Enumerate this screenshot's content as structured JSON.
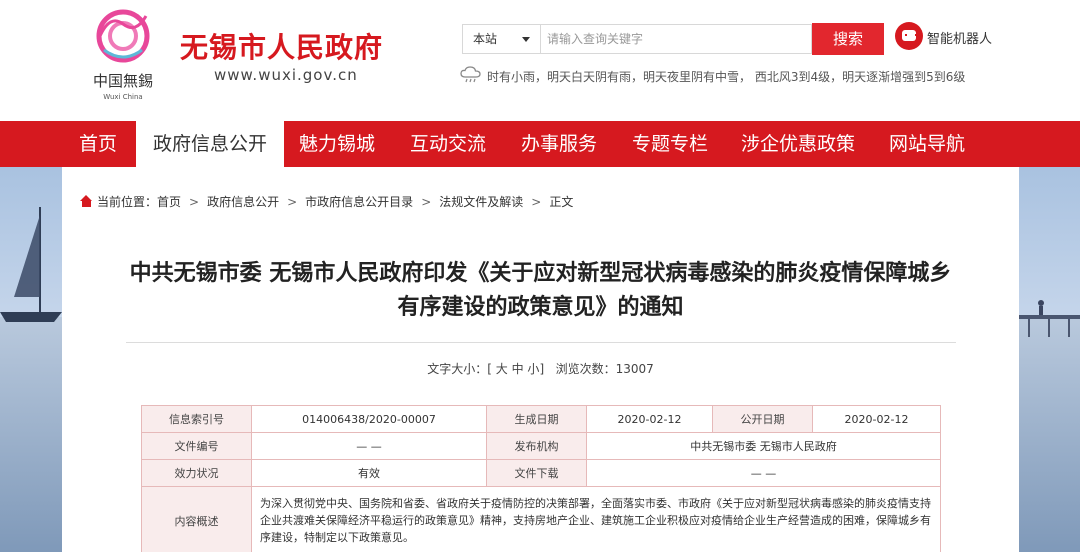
{
  "header": {
    "logo_text": "中国無錫",
    "logo_subtext": "Wuxi China",
    "site_title": "无锡市人民政府",
    "site_domain": "www.wuxi.gov.cn",
    "search": {
      "scope_value": "本站",
      "placeholder": "请输入查询关键字",
      "button_label": "搜索"
    },
    "robot_label": "智能机器人",
    "weather_icon": "cloud-rain-icon",
    "weather_text": "时有小雨，明天白天阴有雨，明天夜里阴有中雪， 西北风3到4级，明天逐渐增强到5到6级"
  },
  "nav": {
    "items": [
      {
        "label": "首页"
      },
      {
        "label": "政府信息公开",
        "active": true
      },
      {
        "label": "魅力锡城"
      },
      {
        "label": "互动交流"
      },
      {
        "label": "办事服务"
      },
      {
        "label": "专题专栏"
      },
      {
        "label": "涉企优惠政策"
      },
      {
        "label": "网站导航"
      }
    ]
  },
  "breadcrumb": {
    "prefix": "当前位置：",
    "items": [
      "首页",
      "政府信息公开",
      "市政府信息公开目录",
      "法规文件及解读",
      "正文"
    ],
    "separator": ">"
  },
  "article": {
    "title_line1": "中共无锡市委 无锡市人民政府印发《关于应对新型冠状病毒感染的肺炎疫情保障城乡",
    "title_line2": "有序建设的政策意见》的通知",
    "font_size_label": "文字大小：[",
    "font_large": "大",
    "font_medium": "中",
    "font_small": "小",
    "font_size_close": "]",
    "views_label": "浏览次数：",
    "views_count": "13007"
  },
  "info_table": {
    "index_key": "信息索引号",
    "index_value": "014006438/2020-00007",
    "created_key": "生成日期",
    "created_value": "2020-02-12",
    "published_key": "公开日期",
    "published_value": "2020-02-12",
    "docno_key": "文件编号",
    "docno_value": "— —",
    "issuer_key": "发布机构",
    "issuer_value": "中共无锡市委 无锡市人民政府",
    "status_key": "效力状况",
    "status_value": "有效",
    "download_key": "文件下载",
    "download_value": "— —",
    "summary_key": "内容概述",
    "summary_value": "为深入贯彻党中央、国务院和省委、省政府关于疫情防控的决策部署，全面落实市委、市政府《关于应对新型冠状病毒感染的肺炎疫情支持企业共渡难关保障经济平稳运行的政策意见》精神，支持房地产企业、建筑施工企业积极应对疫情给企业生产经营造成的困难，保障城乡有序建设，特制定以下政策意见。"
  },
  "colors": {
    "brand_red": "#d6191f",
    "table_border": "#e6b9b9",
    "table_key_bg": "#f9ecec"
  }
}
